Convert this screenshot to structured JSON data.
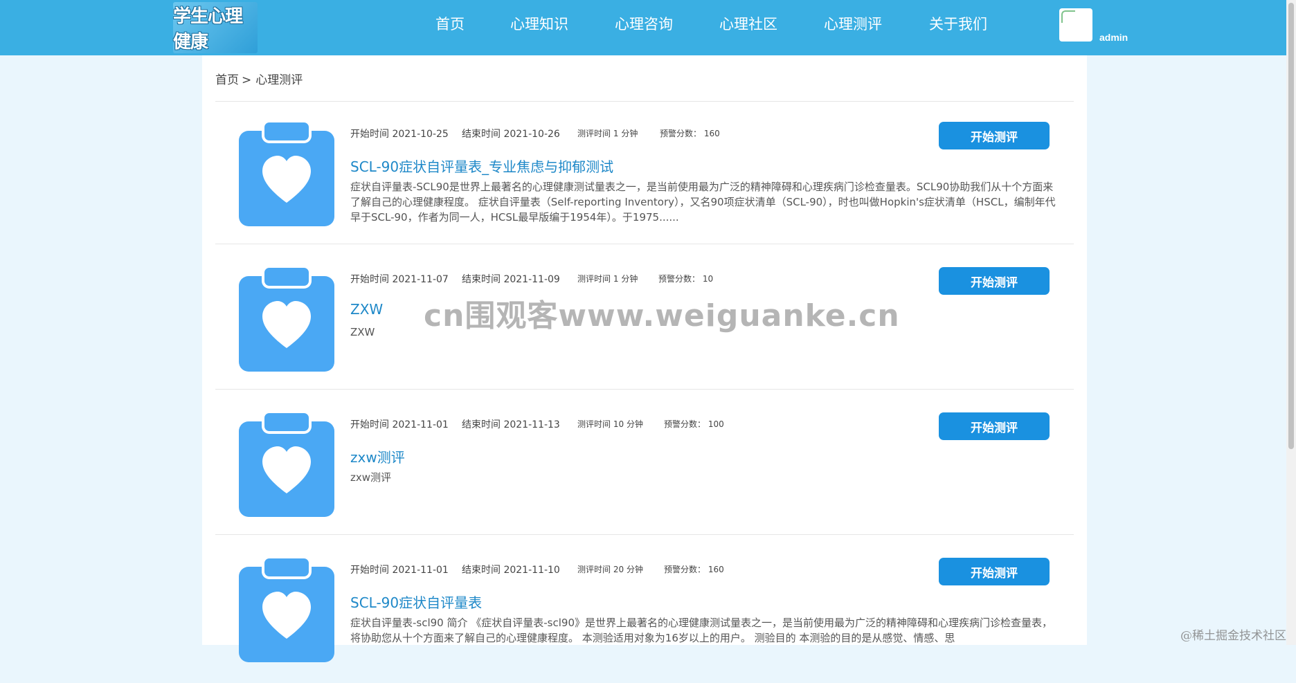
{
  "header": {
    "logo_text": "学生心理健康",
    "nav": [
      "首页",
      "心理知识",
      "心理咨询",
      "心理社区",
      "心理测评",
      "关于我们"
    ],
    "username": "admin"
  },
  "breadcrumb": {
    "home": "首页",
    "separator": ">",
    "current": "心理测评"
  },
  "labels": {
    "start_time": "开始时间",
    "end_time": "结束时间",
    "duration": "测评时间",
    "minutes": "分钟",
    "warning_score": "预警分数："
  },
  "assessments": [
    {
      "start": "2021-10-25",
      "end": "2021-10-26",
      "duration": "1",
      "warning": "160",
      "title": "SCL-90症状自评量表_专业焦虑与抑郁测试",
      "description": "症状自评量表-SCL90是世界上最著名的心理健康测试量表之一，是当前使用最为广泛的精神障碍和心理疾病门诊检查量表。SCL90协助我们从十个方面来了解自己的心理健康程度。 症状自评量表（Self-reporting Inventory），又名90项症状清单（SCL-90），时也叫做Hopkin's症状清单（HSCL，编制年代早于SCL-90，作者为同一人，HCSL最早版编于1954年）。于1975......",
      "button": "开始测评"
    },
    {
      "start": "2021-11-07",
      "end": "2021-11-09",
      "duration": "1",
      "warning": "10",
      "title": "ZXW",
      "description": "ZXW",
      "button": "开始测评"
    },
    {
      "start": "2021-11-01",
      "end": "2021-11-13",
      "duration": "10",
      "warning": "100",
      "title": "zxw测评",
      "description": "zxw测评",
      "button": "开始测评"
    },
    {
      "start": "2021-11-01",
      "end": "2021-11-10",
      "duration": "20",
      "warning": "160",
      "title": "SCL-90症状自评量表",
      "description": "症状自评量表-scl90 简介 《症状自评量表-scl90》是世界上最著名的心理健康测试量表之一，是当前使用最为广泛的精神障碍和心理疾病门诊检查量表，将协助您从十个方面来了解自己的心理健康程度。 本测验适用对象为16岁以上的用户。 测验目的 本测验的目的是从感觉、情感、思",
      "button": "开始测评"
    }
  ],
  "watermark": "cn围观客www.weiguanke.cn",
  "corner_watermark": "@稀土掘金技术社区",
  "colors": {
    "header": "#3aafe3",
    "accent": "#1a91e0",
    "title": "#1e88c8",
    "icon": "#4aa8f4"
  }
}
